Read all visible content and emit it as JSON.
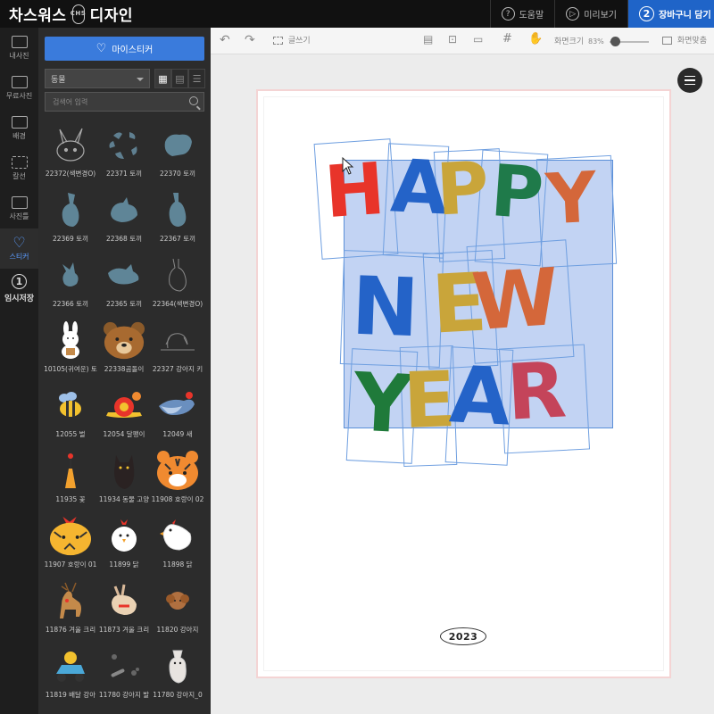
{
  "brand": {
    "name": "차스워스",
    "suffix": "디자인",
    "mark": "CHS"
  },
  "topnav": {
    "help": "도움말",
    "preview": "미리보기",
    "cart": "장바구니 담기",
    "cart_step": "2"
  },
  "rail": {
    "items": [
      {
        "label": "내사진"
      },
      {
        "label": "무료사진"
      },
      {
        "label": "배경"
      },
      {
        "label": "칼선"
      },
      {
        "label": "사진틀"
      },
      {
        "label": "스티커"
      },
      {
        "label": "임시저장",
        "step": "1"
      }
    ]
  },
  "panel": {
    "mysticker_label": "마이스티커",
    "category": "동물",
    "search_placeholder": "검색어 입력",
    "stickers": [
      {
        "name": "22372(색변경O)"
      },
      {
        "name": "22371 토끼"
      },
      {
        "name": "22370 토끼"
      },
      {
        "name": "22369 토끼"
      },
      {
        "name": "22368 토끼"
      },
      {
        "name": "22367 토끼"
      },
      {
        "name": "22366 토끼"
      },
      {
        "name": "22365 토끼"
      },
      {
        "name": "22364(색변경O)"
      },
      {
        "name": "10105(귀여운) 토"
      },
      {
        "name": "22338곰돌이"
      },
      {
        "name": "22327 강아지 키"
      },
      {
        "name": "12055 벌"
      },
      {
        "name": "12054 달팽이"
      },
      {
        "name": "12049 새"
      },
      {
        "name": "11935 꽃"
      },
      {
        "name": "11934 동물 고양"
      },
      {
        "name": "11908 호랑이 02"
      },
      {
        "name": "11907 호랑이 01"
      },
      {
        "name": "11899 닭"
      },
      {
        "name": "11898 닭"
      },
      {
        "name": "11876 겨울 크리"
      },
      {
        "name": "11873 겨울 크리"
      },
      {
        "name": "11820 강아지"
      },
      {
        "name": "11819 배달 강아"
      },
      {
        "name": "11780 강아지 발"
      },
      {
        "name": "11780 강아지_0"
      }
    ]
  },
  "toolbar": {
    "text_label": "글쓰기",
    "zoom_label": "화면크기",
    "zoom_value": "83%",
    "fit_label": "화면맞춤"
  },
  "canvas": {
    "happy": [
      "H",
      "A",
      "P",
      "P",
      "Y"
    ],
    "new": [
      "N",
      "E",
      "W"
    ],
    "year_letters": [
      "Y",
      "E",
      "A",
      "R"
    ],
    "year_badge": "2023"
  },
  "colors": {
    "accent": "#1f64c8",
    "sticker_button": "#3a7bdc",
    "selection": "#5b8fd8"
  }
}
